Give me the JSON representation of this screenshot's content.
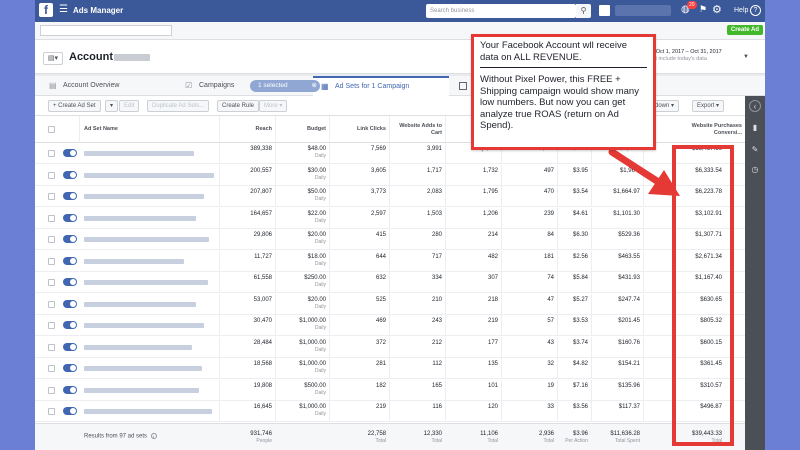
{
  "colors": {
    "accent": "#4267b2",
    "fb_blue": "#3b5998",
    "annotation_red": "#e53935",
    "success_green": "#42b72a"
  },
  "header": {
    "logo": "f",
    "title": "Ads Manager",
    "search_placeholder": "Search business",
    "notification_count": "20",
    "help_label": "Help",
    "help_icon": "?"
  },
  "subbar": {
    "create_ad_label": "Create Ad"
  },
  "account": {
    "label": "Account:",
    "date_range": "nth: Oct 1, 2017 – Oct 31, 2017",
    "date_note": "s not include today's data"
  },
  "tabs": [
    {
      "label": "Account Overview",
      "icon": "▤"
    },
    {
      "label": "Campaigns",
      "icon": "☑"
    },
    {
      "label": "Ad Sets for 1 Campaign",
      "icon": "▦"
    }
  ],
  "selected_pill": {
    "label": "1 selected",
    "close": "⊗"
  },
  "toolbar": {
    "create_ad_set": "+ Create Ad Set",
    "edit": "Edit",
    "duplicate": "Duplicate Ad Sets...",
    "create_rule": "Create Rule",
    "more": "More ▾",
    "breakdown": "kdown ▾",
    "export": "Export ▾"
  },
  "table": {
    "headers": [
      "Ad Set Name",
      "Reach",
      "Budget",
      "Link Clicks",
      "Website Adds to Cart",
      "",
      "",
      "",
      "",
      "Website Purchases Conversi..."
    ],
    "rows": [
      {
        "name_w": 110,
        "reach": "389,338",
        "budget": "$48.00",
        "budget_sub": "Daily",
        "clicks": "7,569",
        "atc": "3,991",
        "c6": "(3,665",
        "c7": "1,022",
        "c8": "$3.96",
        "c9": "$1,964.",
        "purch": "$13,437.56"
      },
      {
        "name_w": 130,
        "reach": "200,557",
        "budget": "$30.00",
        "budget_sub": "Daily",
        "clicks": "3,605",
        "atc": "1,717",
        "c6": "1,732",
        "c7": "497",
        "c8": "$3.95",
        "c9": "$1,964.",
        "purch": "$6,333.54"
      },
      {
        "name_w": 120,
        "reach": "207,807",
        "budget": "$50.00",
        "budget_sub": "Daily",
        "clicks": "3,773",
        "atc": "2,083",
        "c6": "1,795",
        "c7": "470",
        "c8": "$3.54",
        "c9": "$1,664.97",
        "purch": "$6,223.78"
      },
      {
        "name_w": 112,
        "reach": "164,657",
        "budget": "$22.00",
        "budget_sub": "Daily",
        "clicks": "2,597",
        "atc": "1,503",
        "c6": "1,206",
        "c7": "239",
        "c8": "$4.61",
        "c9": "$1,101.30",
        "purch": "$3,102.91"
      },
      {
        "name_w": 125,
        "reach": "29,806",
        "budget": "$20.00",
        "budget_sub": "Daily",
        "clicks": "415",
        "atc": "280",
        "c6": "214",
        "c7": "84",
        "c8": "$6.30",
        "c9": "$529.36",
        "purch": "$1,307.71"
      },
      {
        "name_w": 100,
        "reach": "11,727",
        "budget": "$18.00",
        "budget_sub": "Daily",
        "clicks": "644",
        "atc": "717",
        "c6": "482",
        "c7": "181",
        "c8": "$2.56",
        "c9": "$463.55",
        "purch": "$2,671.34"
      },
      {
        "name_w": 124,
        "reach": "61,558",
        "budget": "$250.00",
        "budget_sub": "Daily",
        "clicks": "632",
        "atc": "334",
        "c6": "307",
        "c7": "74",
        "c8": "$5.84",
        "c9": "$431.93",
        "purch": "$1,167.40"
      },
      {
        "name_w": 112,
        "reach": "53,007",
        "budget": "$20.00",
        "budget_sub": "Daily",
        "clicks": "525",
        "atc": "210",
        "c6": "218",
        "c7": "47",
        "c8": "$5.27",
        "c9": "$247.74",
        "purch": "$630.65"
      },
      {
        "name_w": 120,
        "reach": "30,470",
        "budget": "$1,000.00",
        "budget_sub": "Daily",
        "clicks": "469",
        "atc": "243",
        "c6": "219",
        "c7": "57",
        "c8": "$3.53",
        "c9": "$201.45",
        "purch": "$805.32"
      },
      {
        "name_w": 108,
        "reach": "28,484",
        "budget": "$1,000.00",
        "budget_sub": "Daily",
        "clicks": "372",
        "atc": "212",
        "c6": "177",
        "c7": "43",
        "c8": "$3.74",
        "c9": "$160.76",
        "purch": "$600.15"
      },
      {
        "name_w": 118,
        "reach": "18,568",
        "budget": "$1,000.00",
        "budget_sub": "Daily",
        "clicks": "281",
        "atc": "112",
        "c6": "135",
        "c7": "32",
        "c8": "$4.82",
        "c9": "$154.21",
        "purch": "$361.45"
      },
      {
        "name_w": 115,
        "reach": "19,808",
        "budget": "$500.00",
        "budget_sub": "Daily",
        "clicks": "182",
        "atc": "165",
        "c6": "101",
        "c7": "19",
        "c8": "$7.16",
        "c9": "$135.96",
        "purch": "$310.57"
      },
      {
        "name_w": 128,
        "reach": "16,645",
        "budget": "$1,000.00",
        "budget_sub": "Daily",
        "clicks": "219",
        "atc": "116",
        "c6": "120",
        "c7": "33",
        "c8": "$3.56",
        "c9": "$117.37",
        "purch": "$496.87"
      }
    ],
    "totals": {
      "label": "Results from 97 ad sets",
      "info_icon": "i",
      "reach": "931,746",
      "reach_sub": "People",
      "clicks": "22,758",
      "clicks_sub": "Total",
      "atc": "12,330",
      "atc_sub": "Total",
      "c6": "11,106",
      "c6_sub": "Total",
      "c7": "2,936",
      "c7_sub": "Total",
      "c8": "$3.96",
      "c8_sub": "Per Action",
      "c9": "$11,636.28",
      "c9_sub": "Total Spent",
      "purch": "$39,443.33",
      "purch_sub": "Total"
    }
  },
  "callout": {
    "p1": "Your Facebook Account wll receive data on ALL REVENUE.",
    "p2": "Without Pixel Power, this FREE + Shipping campaign would show many low numbers.  But now you can get analyze true ROAS (return on Ad Spend)."
  }
}
